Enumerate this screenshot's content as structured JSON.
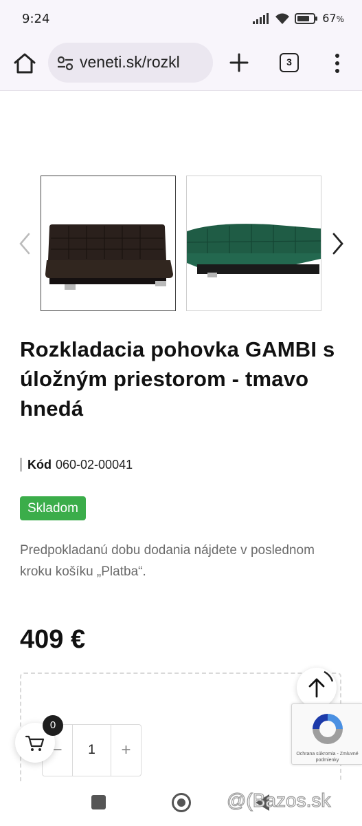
{
  "status_bar": {
    "time": "9:24",
    "battery": "67",
    "battery_unit": "%"
  },
  "browser": {
    "url": "veneti.sk/rozkl",
    "tab_count": "3"
  },
  "gallery": {
    "images": [
      {
        "alt": "tmavo hnedá pohovka",
        "color": "#2a201c"
      },
      {
        "alt": "zelená pohovka",
        "color": "#1f5c45"
      }
    ]
  },
  "product": {
    "title": "Rozkladacia pohovka GAMBI s úložným priestorom - tmavo hnedá",
    "code_label": "Kód",
    "code_value": "060-02-00041",
    "stock": "Skladom",
    "delivery_note": "Predpokladanú dobu dodania nájdete v poslednom kroku košíku „Platba“.",
    "price": "409 €"
  },
  "cart": {
    "quantity": "1",
    "minus": "−",
    "plus": "+",
    "count": "0"
  },
  "recaptcha": {
    "text": "Ochrana súkromia - Zmluvné podmienky"
  },
  "watermark": "@(Bazos.sk",
  "colors": {
    "accent_green": "#3bad4a",
    "browser_bg": "#f8f5fb"
  }
}
